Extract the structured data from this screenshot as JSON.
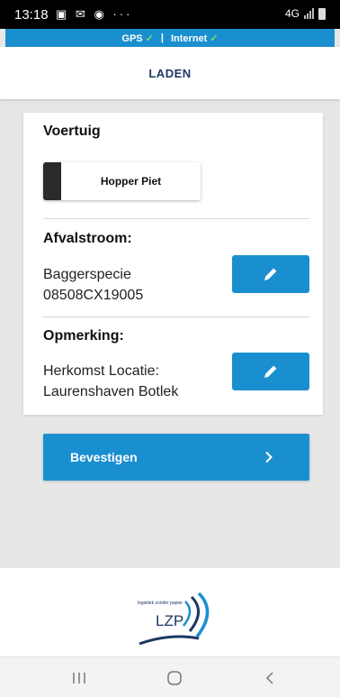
{
  "status_bar": {
    "time": "13:18",
    "notification_icons": [
      "image-icon",
      "chat-icon",
      "browser-icon"
    ],
    "more": "···",
    "network": "4G"
  },
  "connection_bar": {
    "gps_label": "GPS",
    "gps_ok": "✓",
    "separator": "|",
    "internet_label": "Internet",
    "internet_ok": "✓",
    "background": "#1a8fcf",
    "ok_color": "#7dd96b"
  },
  "header": {
    "title": "LADEN",
    "title_color": "#1e3864"
  },
  "vehicle": {
    "title": "Voertuig",
    "selected": "Hopper Piet"
  },
  "waste_stream": {
    "title": "Afvalstroom:",
    "line1": "Baggerspecie",
    "line2": "08508CX19005",
    "edit_icon": "pencil-icon"
  },
  "remark": {
    "title": "Opmerking:",
    "line1": "Herkomst Locatie:",
    "line2": "Laurenshaven Botlek",
    "edit_icon": "pencil-icon"
  },
  "confirm": {
    "label": "Bevestigen",
    "icon": "chevron-right-icon"
  },
  "footer": {
    "logo_text": "LZP",
    "logo_tagline": "logistiek zonder papier"
  },
  "nav": {
    "recents_icon": "recent-apps-icon",
    "home_icon": "home-icon",
    "back_icon": "back-icon"
  },
  "colors": {
    "accent": "#1a8fcf",
    "background": "#e7e7e7"
  }
}
